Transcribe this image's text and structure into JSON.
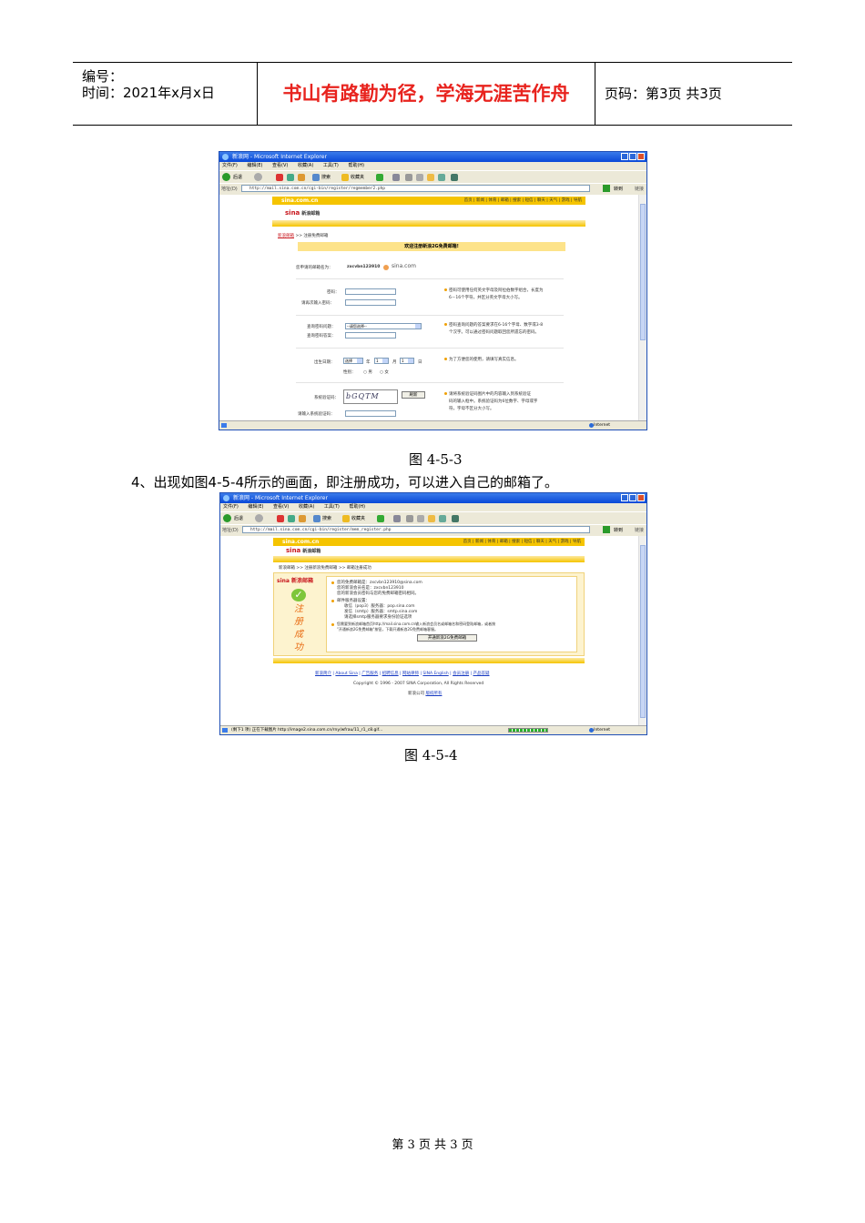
{
  "header": {
    "number_label": "编号：",
    "time_label": "时间：2021年x月x日",
    "motto": "书山有路勤为径，学海无涯苦作舟",
    "page_info": "页码：第3页  共3页"
  },
  "browser": {
    "title": "新浪网 - Microsoft Internet Explorer",
    "menus": [
      "文件(F)",
      "编辑(E)",
      "查看(V)",
      "收藏(A)",
      "工具(T)",
      "帮助(H)"
    ],
    "back_label": "后退",
    "search_label": "搜索",
    "favorites_label": "收藏夹",
    "address_label": "地址(D)",
    "go_label": "转到",
    "links_label": "链接",
    "zone_label": "Internet"
  },
  "figure1": {
    "url": "http://mail.sina.com.cn/cgi-bin/register/regmember2.php",
    "domain": "sina.com.cn",
    "nav": "首页 | 新闻 | 体育 | 邮箱 | 搜索 | 短信 | 聊天 | 天气 | 游戏 | 导航",
    "logo_text": "sina",
    "logo_sub": "新浪邮箱",
    "breadcrumb_link": "新浪邮箱",
    "breadcrumb_rest": ">> 注册免费邮箱",
    "welcome": "欢迎注册新浪2G免费邮箱!",
    "mail_name_label": "您申请的邮箱名为：",
    "mail_name_value": "zxcvbn123910",
    "mail_domain": "sina.com",
    "password_label": "密码：",
    "password_again_label": "请再次输入密码：",
    "password_hint_1": "密码可使用任何英文字母及阿拉伯数字组合，长度为",
    "password_hint_2": "6－16个字符，并区分英文字母大小写。",
    "question_label": "查询密码问题：",
    "question_value": "--请您选择--",
    "answer_label": "查询密码答案：",
    "question_hint_1": "密码查询问题的答案要求在6-16个字母、数字或3-8",
    "question_hint_2": "个汉字。可以通过密码问题取回您所遗忘的密码。",
    "birthday_label": "出生日期：",
    "birthday_year_value": "选择",
    "year_label": "年",
    "birthday_month_value": "1",
    "month_label": "月",
    "birthday_day_value": "1",
    "day_label": "日",
    "gender_label": "性别：",
    "male_label": "男",
    "female_label": "女",
    "birthday_hint": "为了方便您的使用，请填写真实信息。",
    "captcha_label": "系统验证码：",
    "captcha_text": "bGQTM",
    "refresh_label": "刷新",
    "captcha_input_label": "请输入系统验证码：",
    "captcha_hint_1": "请将系统验证码图片中的内容输入到系统验证",
    "captcha_hint_2": "码的输入框中。系统验证码为6位数字、字母或字",
    "captcha_hint_3": "符，字母不区分大小写。",
    "caption": "图 4-5-3"
  },
  "paragraph": "4、出现如图4-5-4所示的画面，即注册成功，可以进入自己的邮箱了。",
  "figure2": {
    "url": "http://mail.sina.com.cn/cgi-bin/register/mem_register.php",
    "domain": "sina.com.cn",
    "nav": "首页 | 新闻 | 体育 | 邮箱 | 搜索 | 短信 | 聊天 | 天气 | 游戏 | 导航",
    "logo_text": "sina",
    "logo_sub": "新浪邮箱",
    "breadcrumb": "新浪邮箱 >> 注册新浪免费邮箱 >> 邮箱注册成功",
    "side_logo": "sina 新浪邮箱",
    "side_chars": [
      "注",
      "册",
      "成",
      "功"
    ],
    "line1": "您的免费邮箱是：zxcvbn123910@sina.com",
    "line2": "您的新浪会员名是：zxcvbn123910",
    "line3": "您的新浪会员密码与您的免费邮箱密码相同。",
    "line4": "邮件服务器设置：",
    "line5": "收信（pop3）服务器：pop.sina.com",
    "line6": "发信（smtp）服务器：smtp.sina.com",
    "line7": "请选择smtp服务器要求身份验证选项",
    "line8": "您需要到新浪邮箱首页http://mail.sina.com.cn输入新浪会员名或邮箱名和密码登陆邮箱，或者按",
    "line9": "\"开通新浪2G免费邮箱\"按钮，下载开通新浪2G免费邮箱客服。",
    "open_button": "开通新浪2G免费邮箱",
    "footer_links": [
      "新浪简介",
      "About Sina",
      "广告服务",
      "招聘信息",
      "网站律师",
      "SINA English",
      "会员注册",
      "产品答疑"
    ],
    "copyright": "Copyright © 1996 - 2007 SINA Corporation, All Rights Reserved",
    "company": "新浪公司",
    "company_link": "版权所有",
    "status": "(剩下1 项) 正在下载图片 http://image2.sina.com.cn/rny/wfrau/11_r1_c8.gif...",
    "caption": "图 4-5-4"
  },
  "footer": {
    "page_number": "第 3 页 共 3 页"
  },
  "colors": {
    "motto": "#e8231e",
    "sina_yellow": "#f5c400",
    "sina_red": "#c8161d"
  }
}
